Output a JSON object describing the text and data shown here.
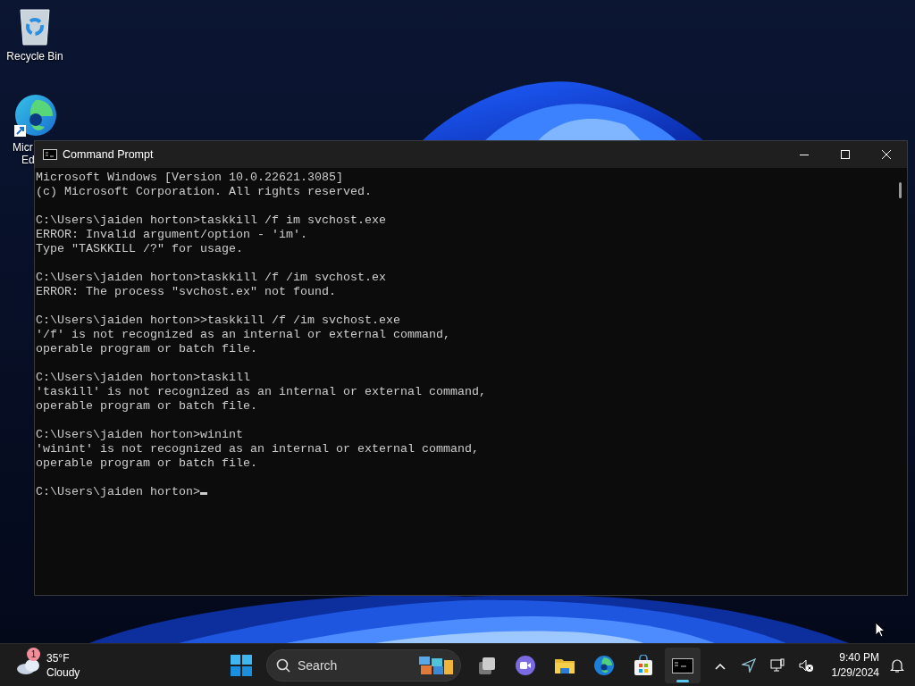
{
  "desktop": {
    "icons": [
      {
        "kind": "recycle",
        "label": [
          "Recycle Bin"
        ]
      },
      {
        "kind": "edge",
        "label": [
          "Micr",
          "Ed"
        ]
      }
    ]
  },
  "window": {
    "title": "Command Prompt",
    "console": {
      "blocks": [
        [
          "Microsoft Windows [Version 10.0.22621.3085]",
          "(c) Microsoft Corporation. All rights reserved."
        ],
        [
          "C:\\Users\\jaiden horton>taskkill /f im svchost.exe",
          "ERROR: Invalid argument/option - 'im'.",
          "Type \"TASKKILL /?\" for usage."
        ],
        [
          "C:\\Users\\jaiden horton>taskkill /f /im svchost.ex",
          "ERROR: The process \"svchost.ex\" not found."
        ],
        [
          "C:\\Users\\jaiden horton>>taskkill /f /im svchost.exe",
          "'/f' is not recognized as an internal or external command,",
          "operable program or batch file."
        ],
        [
          "C:\\Users\\jaiden horton>taskill",
          "'taskill' is not recognized as an internal or external command,",
          "operable program or batch file."
        ],
        [
          "C:\\Users\\jaiden horton>winint",
          "'winint' is not recognized as an internal or external command,",
          "operable program or batch file."
        ]
      ],
      "prompt": "C:\\Users\\jaiden horton>",
      "cursor": true
    }
  },
  "taskbar": {
    "weather": {
      "temperature": "35°F",
      "condition": "Cloudy",
      "badge": "1"
    },
    "search": {
      "label": "Search"
    },
    "apps": [
      {
        "kind": "taskview",
        "selected": false
      },
      {
        "kind": "meet",
        "selected": false
      },
      {
        "kind": "explorer",
        "selected": false
      },
      {
        "kind": "edge",
        "selected": false
      },
      {
        "kind": "store",
        "selected": false
      },
      {
        "kind": "terminal",
        "selected": true
      }
    ],
    "clock": {
      "time": "9:40 PM",
      "date": "1/29/2024"
    }
  }
}
